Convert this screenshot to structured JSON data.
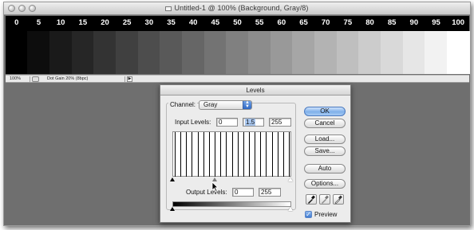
{
  "window": {
    "title": "Untitled-1 @ 100% (Background, Gray/8)"
  },
  "step_wedge": {
    "labels": [
      "0",
      "5",
      "10",
      "15",
      "20",
      "25",
      "30",
      "35",
      "40",
      "45",
      "50",
      "55",
      "60",
      "65",
      "70",
      "75",
      "80",
      "85",
      "90",
      "95",
      "100"
    ]
  },
  "statusbar": {
    "zoom": "100%",
    "info": "Dot Gain 20% (8bpc)"
  },
  "dialog": {
    "title": "Levels",
    "channel_label": "Channel:",
    "channel_value": "Gray",
    "input_label": "Input Levels:",
    "input_black": "0",
    "input_gamma": "1.5",
    "input_white": "255",
    "output_label": "Output Levels:",
    "output_black": "0",
    "output_white": "255",
    "buttons": {
      "ok": "OK",
      "cancel": "Cancel",
      "load": "Load...",
      "save": "Save...",
      "auto": "Auto",
      "options": "Options..."
    },
    "preview_label": "Preview",
    "preview_checked": true
  }
}
